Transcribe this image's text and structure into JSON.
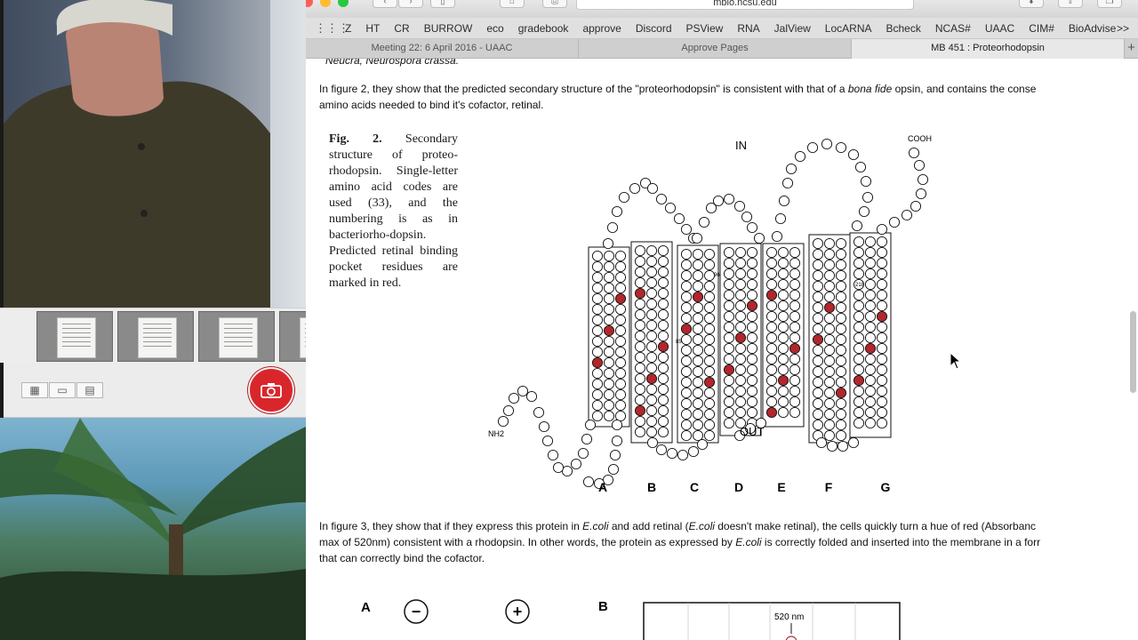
{
  "photobooth": {
    "view_icons": [
      "grid-view-icon",
      "single-view-icon",
      "filmstrip-view-icon"
    ]
  },
  "safari": {
    "url": "mbio.ncsu.edu",
    "favorites": [
      "Z",
      "HT",
      "CR",
      "BURROW",
      "eco",
      "gradebook",
      "approve",
      "Discord",
      "PSView",
      "RNA",
      "JalView",
      "LocARNA",
      "Bcheck",
      "NCAS#",
      "UAAC",
      "CIM#",
      "BioAdvise"
    ],
    "favorites_more": ">>",
    "tabs": [
      {
        "label": "Meeting 22: 6 April 2016 - UAAC",
        "active": false
      },
      {
        "label": "Approve Pages",
        "active": false
      },
      {
        "label": "MB 451 : Proteorhodopsin",
        "active": true
      }
    ],
    "new_tab": "+"
  },
  "page": {
    "top_cut": "Neucra, Neurospora crassa.",
    "p1_a": "In figure 2, they show that the predicted secondary structure of the \"proteorhodopsin\" is consistent with that of a ",
    "p1_em": "bona fide",
    "p1_b": " opsin, and contains the conse",
    "p1_line2": "amino acids needed to bind it's cofactor, retinal.",
    "caption": {
      "label": "Fig. 2.",
      "text": "Secondary structure of proteo-rhodopsin. Single-letter amino acid codes are used (33), and the numbering is as in bacteriorho-dopsin. Predicted retinal binding pocket residues are marked in red."
    },
    "p2_a": "In figure 3, they show that if they express this protein in ",
    "p2_em1": "E.coli",
    "p2_b": " and add retinal (",
    "p2_em2": "E.coli",
    "p2_c": " doesn't make retinal), the cells quickly turn a hue of red (Absorbanc",
    "p2_line2a": "max of 520nm) consistent with a rhodopsin. In other words, the protein as expressed by ",
    "p2_em3": "E.coli",
    "p2_line2b": " is correctly folded and inserted into the membrane in a forr",
    "p2_line3": "that can correctly bind the cofactor."
  },
  "figure": {
    "in_label": "IN",
    "out_label": "OUT",
    "cooh": "COOH",
    "nh2": "NH2",
    "helices": [
      "A",
      "B",
      "C",
      "D",
      "E",
      "F",
      "G"
    ],
    "red_color": "#b3262a",
    "num_218": "218",
    "num_85": "85",
    "num_96": "96"
  },
  "figure3": {
    "panel_a": "A",
    "panel_b": "B",
    "minus": "−",
    "plus": "+",
    "peak": "520 nm"
  }
}
